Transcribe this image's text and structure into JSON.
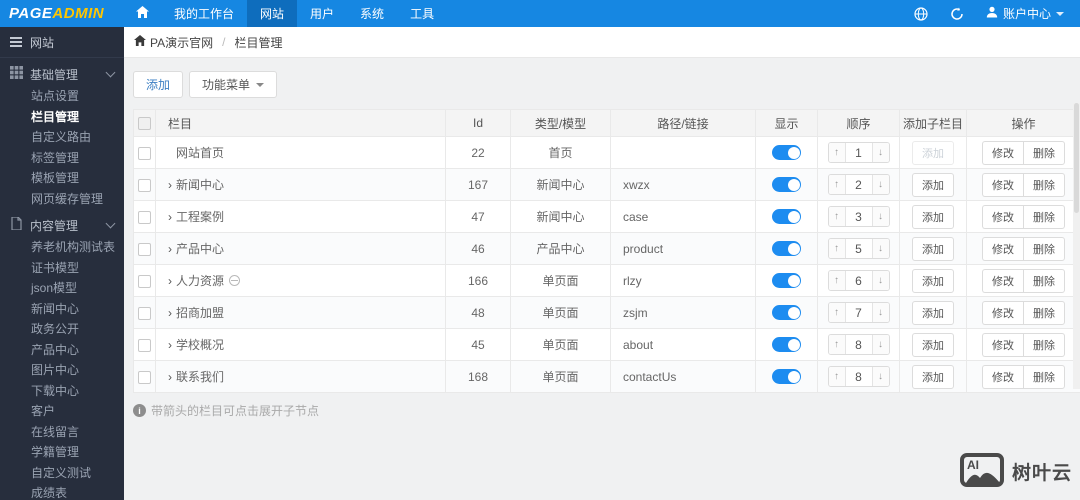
{
  "topnav": {
    "logo_part1": "PAGE",
    "logo_part2": "ADMIN",
    "items": [
      {
        "label": "我的工作台",
        "active": false
      },
      {
        "label": "网站",
        "active": true
      },
      {
        "label": "用户",
        "active": false
      },
      {
        "label": "系统",
        "active": false
      },
      {
        "label": "工具",
        "active": false
      }
    ],
    "account_label": "账户中心"
  },
  "sidebar": {
    "title": "网站",
    "groups": [
      {
        "label": "基础管理",
        "icon": "grid-icon",
        "items": [
          "站点设置",
          "栏目管理",
          "自定义路由",
          "标签管理",
          "模板管理",
          "网页缓存管理"
        ],
        "active_item": "栏目管理"
      },
      {
        "label": "内容管理",
        "icon": "document-icon",
        "items": [
          "养老机构测试表",
          "证书模型",
          "json模型",
          "新闻中心",
          "政务公开",
          "产品中心",
          "图片中心",
          "下载中心",
          "客户",
          "在线留言",
          "学籍管理",
          "自定义测试",
          "成绩表"
        ],
        "active_item": ""
      }
    ]
  },
  "breadcrumb": {
    "site": "PA演示官网",
    "separator": "/",
    "page": "栏目管理"
  },
  "toolbar": {
    "add_label": "添加",
    "menu_label": "功能菜单"
  },
  "table": {
    "headers": [
      "栏目",
      "Id",
      "类型/模型",
      "路径/链接",
      "显示",
      "顺序",
      "添加子栏目",
      "操作"
    ],
    "add_child_label": "添加",
    "edit_label": "修改",
    "delete_label": "删除",
    "rows": [
      {
        "name": "网站首页",
        "has_arrow": false,
        "has_hidden_icon": false,
        "id": "22",
        "type": "首页",
        "path": "",
        "visible": true,
        "order": "1",
        "add_disabled": true
      },
      {
        "name": "新闻中心",
        "has_arrow": true,
        "has_hidden_icon": false,
        "id": "167",
        "type": "新闻中心",
        "path": "xwzx",
        "visible": true,
        "order": "2",
        "add_disabled": false
      },
      {
        "name": "工程案例",
        "has_arrow": true,
        "has_hidden_icon": false,
        "id": "47",
        "type": "新闻中心",
        "path": "case",
        "visible": true,
        "order": "3",
        "add_disabled": false
      },
      {
        "name": "产品中心",
        "has_arrow": true,
        "has_hidden_icon": false,
        "id": "46",
        "type": "产品中心",
        "path": "product",
        "visible": true,
        "order": "5",
        "add_disabled": false
      },
      {
        "name": "人力资源",
        "has_arrow": true,
        "has_hidden_icon": true,
        "id": "166",
        "type": "单页面",
        "path": "rlzy",
        "visible": true,
        "order": "6",
        "add_disabled": false
      },
      {
        "name": "招商加盟",
        "has_arrow": true,
        "has_hidden_icon": false,
        "id": "48",
        "type": "单页面",
        "path": "zsjm",
        "visible": true,
        "order": "7",
        "add_disabled": false
      },
      {
        "name": "学校概况",
        "has_arrow": true,
        "has_hidden_icon": false,
        "id": "45",
        "type": "单页面",
        "path": "about",
        "visible": true,
        "order": "8",
        "add_disabled": false
      },
      {
        "name": "联系我们",
        "has_arrow": true,
        "has_hidden_icon": false,
        "id": "168",
        "type": "单页面",
        "path": "contactUs",
        "visible": true,
        "order": "8",
        "add_disabled": false
      }
    ]
  },
  "footer_note": "带箭头的栏目可点击展开子节点",
  "watermark": {
    "brand": "树叶云",
    "icon_label": "AI"
  },
  "colors": {
    "topnav_blue": "#1687e2",
    "topnav_active_blue": "#0e6dbd",
    "logo_yellow": "#ffc600",
    "sidebar_bg": "#272e3d",
    "toggle_on": "#1d8cf0",
    "header_bg": "#f4f4f4"
  }
}
